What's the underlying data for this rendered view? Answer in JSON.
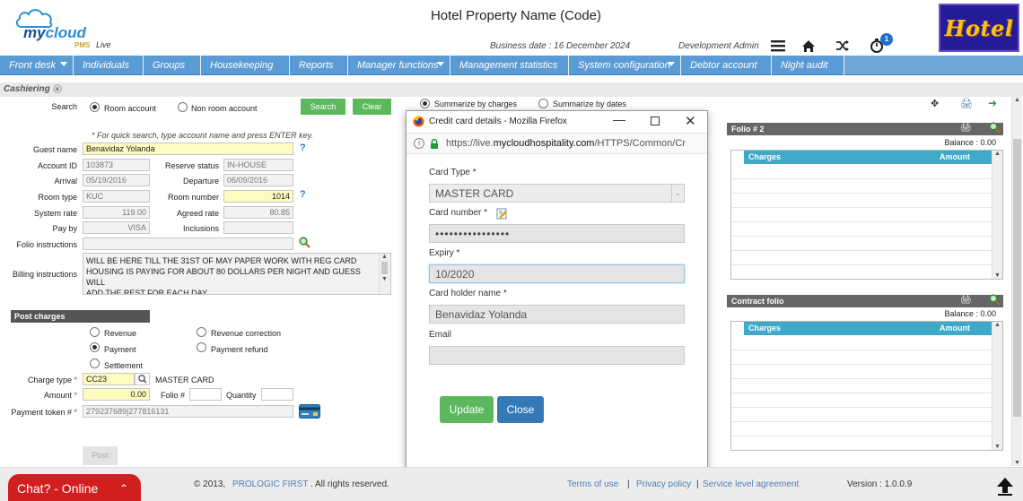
{
  "header": {
    "logo_main": "my",
    "logo_main2": "cloud",
    "logo_pms": "PMS",
    "logo_live": "Live",
    "property_title": "Hotel Property Name (Code)",
    "business_date": "Business date : 16 December 2024",
    "user": "Development Admin",
    "notification_count": "1",
    "hotel_logo_text": "Hotel"
  },
  "nav": {
    "items": [
      {
        "label": "Front desk"
      },
      {
        "label": "Individuals"
      },
      {
        "label": "Groups"
      },
      {
        "label": "Housekeeping"
      },
      {
        "label": "Reports"
      },
      {
        "label": "Manager functions"
      },
      {
        "label": "Management statistics"
      },
      {
        "label": "System configuration"
      },
      {
        "label": "Debtor account"
      },
      {
        "label": "Night audit"
      }
    ]
  },
  "subbar": {
    "tab_label": "Cashiering",
    "close": "×"
  },
  "summarize": {
    "by_charges": "Summarize by charges",
    "by_dates": "Summarize by dates"
  },
  "search": {
    "label": "Search",
    "room_account": "Room account",
    "non_room_account": "Non room account",
    "search_button": "Search",
    "clear_button": "Clear",
    "hint": "* For quick search, type account name and press ENTER key."
  },
  "guest": {
    "guest_name_label": "Guest name",
    "guest_name": "Benavidaz Yolanda",
    "account_id_label": "Account ID",
    "account_id": "103873",
    "reserve_status_label": "Reserve status",
    "reserve_status": "IN-HOUSE",
    "arrival_label": "Arrival",
    "arrival": "05/19/2016",
    "departure_label": "Departure",
    "departure": "06/09/2016",
    "room_type_label": "Room type",
    "room_type": "KUC",
    "room_number_label": "Room number",
    "room_number": "1014",
    "system_rate_label": "System rate",
    "system_rate": "119.00",
    "agreed_rate_label": "Agreed rate",
    "agreed_rate": "80.85",
    "pay_by_label": "Pay by",
    "pay_by": "VISA",
    "inclusions_label": "Inclusions",
    "inclusions": "",
    "folio_instructions_label": "Folio instructions",
    "folio_instructions": "",
    "billing_instructions_label": "Billing instructions",
    "billing_line1": "WILL BE HERE TILL THE 31ST OF MAY PAPER WORK WITH REG CARD",
    "billing_line2": "HOUSING IS PAYING FOR ABOUT 80 DOLLARS PER NIGHT AND GUESS WILL",
    "billing_line3": "ADD THE REST FOR EACH DAY"
  },
  "post_charges": {
    "title": "Post charges",
    "revenue": "Revenue",
    "revenue_correction": "Revenue correction",
    "payment": "Payment",
    "payment_refund": "Payment refund",
    "settlement": "Settlement",
    "charge_type_label": "Charge type",
    "charge_type": "CC23",
    "charge_type_desc": "MASTER CARD",
    "amount_label": "Amount",
    "amount": "0.00",
    "folio_label": "Folio #",
    "folio": "",
    "quantity_label": "Quantity",
    "quantity": "",
    "token_label": "Payment token #",
    "token": "279237689|277816131",
    "post_button": "Post",
    "required_mark": "*"
  },
  "folio2": {
    "title": "Folio # 2",
    "balance": "Balance : 0.00",
    "col_charges": "Charges",
    "col_amount": "Amount"
  },
  "contract_folio": {
    "title": "Contract folio",
    "balance": "Balance : 0.00",
    "col_charges": "Charges",
    "col_amount": "Amount"
  },
  "modal": {
    "window_title": "Credit card details - Mozilla Firefox",
    "url_prefix": "https://live.",
    "url_domain": "mycloudhospitality.com",
    "url_rest": "/HTTPS/Common/Cr",
    "card_type_label": "Card Type *",
    "card_type": "MASTER CARD",
    "card_number_label": "Card number *",
    "card_number": "••••••••••••••••",
    "expiry_label": "Expiry *",
    "expiry": "10/2020",
    "holder_label": "Card holder name *",
    "holder": "Benavidaz Yolanda",
    "email_label": "Email",
    "email": "",
    "update_button": "Update",
    "close_button": "Close"
  },
  "footer": {
    "copyright_pre": "© 2013,",
    "company": "PROLOGIC FIRST",
    "copyright_post": ". All rights reserved.",
    "terms": "Terms of use",
    "privacy": "Privacy policy",
    "sla": "Service level agreement",
    "sep": "|",
    "version": "Version : 1.0.0.9",
    "chat": "Chat? - Online"
  },
  "colors": {
    "nav_bg": "#5b9bd5",
    "green_button": "#5cb85c",
    "blue_button": "#337ab7",
    "grid_header": "#3fa9c8",
    "highlight_field": "#fdfbbf",
    "chat_red": "#d11f1f"
  }
}
